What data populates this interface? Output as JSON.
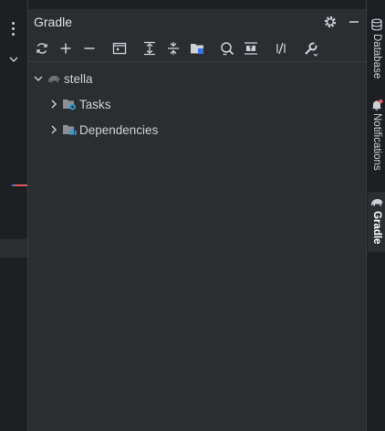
{
  "panel": {
    "title": "Gradle"
  },
  "toolbar": {
    "buttons": [
      {
        "name": "reload-all-icon"
      },
      {
        "name": "add-project-icon"
      },
      {
        "name": "remove-project-icon"
      },
      {
        "name": "run-task-icon"
      },
      {
        "name": "expand-all-icon"
      },
      {
        "name": "collapse-all-icon"
      },
      {
        "name": "open-folder-icon"
      },
      {
        "name": "analyze-dependencies-icon"
      },
      {
        "name": "toggle-offline-icon"
      },
      {
        "name": "build-scripts-icon"
      },
      {
        "name": "settings-wrench-icon"
      }
    ]
  },
  "tree": {
    "project": "stella",
    "children": [
      "Tasks",
      "Dependencies"
    ]
  },
  "right_bar": {
    "database": "Database",
    "notifications": "Notifications",
    "gradle": "Gradle"
  },
  "colors": {
    "panel_bg": "#2b2d30",
    "strip_bg": "#1e1f22",
    "icon": "#ced0d6",
    "accent_blue": "#3574f0",
    "notification_red": "#e55765"
  }
}
